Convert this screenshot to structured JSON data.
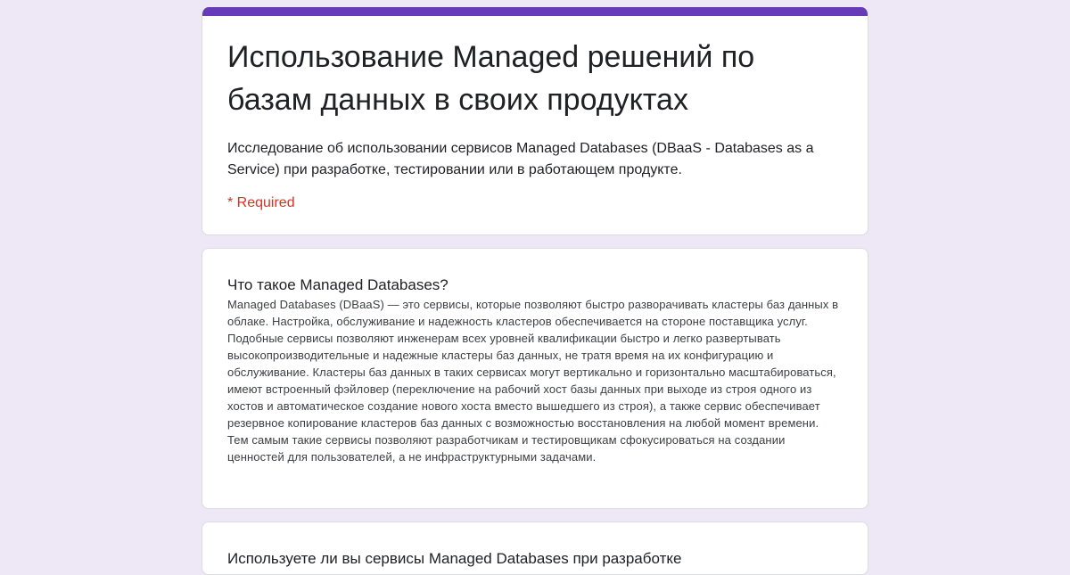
{
  "theme": {
    "accent": "#673ab7",
    "background": "#ede7f6",
    "required_color": "#d93025"
  },
  "form": {
    "title": "Использование Managed решений по базам данных в своих продуктах",
    "description": "Исследование об использовании сервисов Managed Databases (DBaaS - Databases as a Service) при разработке, тестировании или в работающем продукте.",
    "required_note": "* Required"
  },
  "section": {
    "title": "Что такое Managed Databases?",
    "body": "Managed Databases (DBaaS) — это сервисы, которые позволяют быстро разворачивать кластеры баз данных в облаке. Настройка, обслуживание и надежность кластеров обеспечивается на стороне поставщика услуг. Подобные сервисы позволяют инженерам всех уровней квалификации быстро и легко развертывать высокопроизводительные и надежные кластеры баз данных, не тратя время на их конфигурацию и обслуживание. Кластеры баз данных в таких сервисах могут вертикально и горизонтально масштабироваться, имеют встроенный фэйловер (переключение на рабочий хост базы данных при выходе из строя одного из хостов и автоматическое создание нового хоста вместо вышедшего из строя), а также сервис обеспечивает резервное копирование кластеров баз данных с возможностью восстановления на любой момент времени. Тем самым такие сервисы позволяют разработчикам и тестировщикам сфокусироваться на создании ценностей для пользователей, а не инфраструктурными задачами."
  },
  "question": {
    "title": "Используете ли вы сервисы Managed Databases при разработке"
  }
}
